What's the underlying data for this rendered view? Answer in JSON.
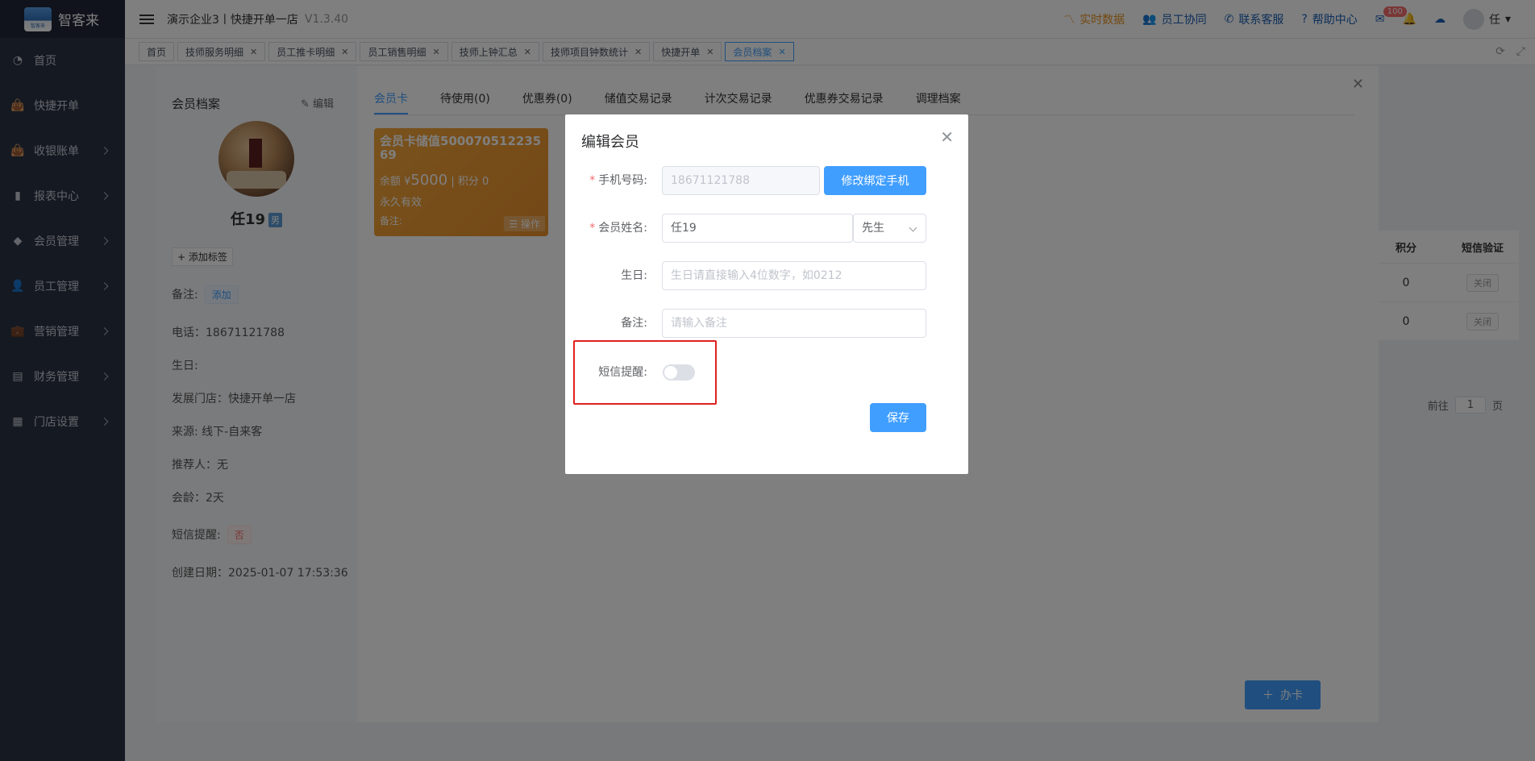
{
  "brand": {
    "name": "智客来",
    "logo_text": "智客来"
  },
  "sidebar": {
    "items": [
      {
        "label": "首页",
        "icon": "dashboard-icon",
        "has_children": false
      },
      {
        "label": "快捷开单",
        "icon": "bag-icon",
        "has_children": false
      },
      {
        "label": "收银账单",
        "icon": "bag-icon",
        "has_children": true
      },
      {
        "label": "报表中心",
        "icon": "bar-chart-icon",
        "has_children": true
      },
      {
        "label": "会员管理",
        "icon": "diamond-icon",
        "has_children": true
      },
      {
        "label": "员工管理",
        "icon": "person-icon",
        "has_children": true
      },
      {
        "label": "营销管理",
        "icon": "briefcase-icon",
        "has_children": true
      },
      {
        "label": "财务管理",
        "icon": "wallet-icon",
        "has_children": true
      },
      {
        "label": "门店设置",
        "icon": "grid-icon",
        "has_children": true
      }
    ]
  },
  "header": {
    "company": "演示企业3丨快捷开单一店",
    "version": "V1.3.40",
    "actions": {
      "realtime": "实时数据",
      "collab": "员工协同",
      "support": "联系客服",
      "help": "帮助中心",
      "mail_badge": "100",
      "user": "任"
    }
  },
  "tabs": [
    {
      "label": "首页",
      "closable": false,
      "active": false
    },
    {
      "label": "技师服务明细",
      "closable": true,
      "active": false
    },
    {
      "label": "员工推卡明细",
      "closable": true,
      "active": false
    },
    {
      "label": "员工销售明细",
      "closable": true,
      "active": false
    },
    {
      "label": "技师上钟汇总",
      "closable": true,
      "active": false
    },
    {
      "label": "技师项目钟数统计",
      "closable": true,
      "active": false
    },
    {
      "label": "快捷开单",
      "closable": true,
      "active": false
    },
    {
      "label": "会员档案",
      "closable": true,
      "active": true
    }
  ],
  "background_table": {
    "headers": [
      "积分",
      "短信验证"
    ],
    "rows": [
      {
        "points": "0",
        "sms": "关闭"
      },
      {
        "points": "0",
        "sms": "关闭"
      }
    ],
    "pager_goto": "前往",
    "pager_page": "1",
    "pager_unit": "页"
  },
  "archive": {
    "title": "会员档案",
    "edit": "编辑",
    "name": "任19",
    "gender": "男",
    "add_tag": "+ 添加标签",
    "note_label": "备注:",
    "note_action": "添加",
    "phone": "电话：18671121788",
    "birthday": "生日:",
    "store": "发展门店：快捷开单一店",
    "source": "来源:   线下-自来客",
    "referrer": "推荐人：无",
    "age": "会龄：2天",
    "sms_label": "短信提醒:",
    "sms_value": "否",
    "created": "创建日期：2025-01-07 17:53:36",
    "tabs": [
      "会员卡",
      "待使用(0)",
      "优惠券(0)",
      "储值交易记录",
      "计次交易记录",
      "优惠券交易记录",
      "调理档案"
    ],
    "card": {
      "title": "会员卡储值50007051223569",
      "balance_prefix": "余额 ¥",
      "balance": "5000",
      "points_text": "| 积分 0",
      "validity": "永久有效",
      "note": "备注:",
      "op": "☰ 操作"
    },
    "add_card": "办卡"
  },
  "dialog": {
    "title": "编辑会员",
    "phone_label": "手机号码:",
    "phone_value": "18671121788",
    "bind_phone_btn": "修改绑定手机",
    "name_label": "会员姓名:",
    "name_value": "任19",
    "title_value": "先生",
    "birthday_label": "生日:",
    "birthday_placeholder": "生日请直接输入4位数字，如0212",
    "note_label": "备注:",
    "note_placeholder": "请输入备注",
    "sms_label": "短信提醒:",
    "sms_enabled": false,
    "save": "保存"
  }
}
